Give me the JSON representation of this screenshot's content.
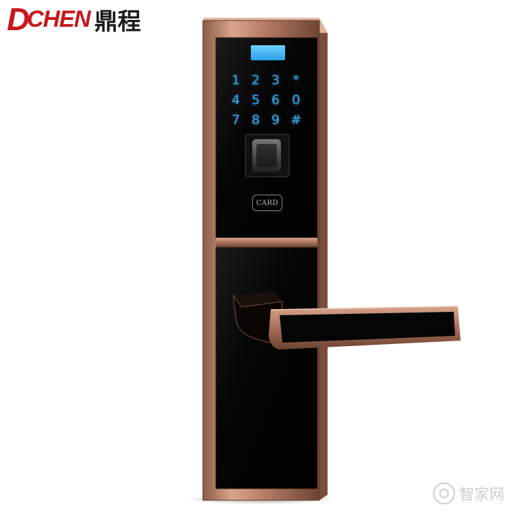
{
  "logo": {
    "brand_d": "D",
    "brand_rest": "CHEN",
    "brand_cn": "鼎程",
    "color_red": "#c8161d",
    "color_dark": "#1a1a1a"
  },
  "keypad": {
    "keys": [
      "1",
      "2",
      "3",
      "*",
      "4",
      "5",
      "6",
      "0",
      "7",
      "8",
      "9",
      "#"
    ],
    "key_color": "#35a7e6"
  },
  "card_reader": {
    "label": "CARD"
  },
  "watermark": {
    "text": "智家网"
  },
  "colors": {
    "bronze": "#b9806a",
    "panel_black": "#050505"
  }
}
